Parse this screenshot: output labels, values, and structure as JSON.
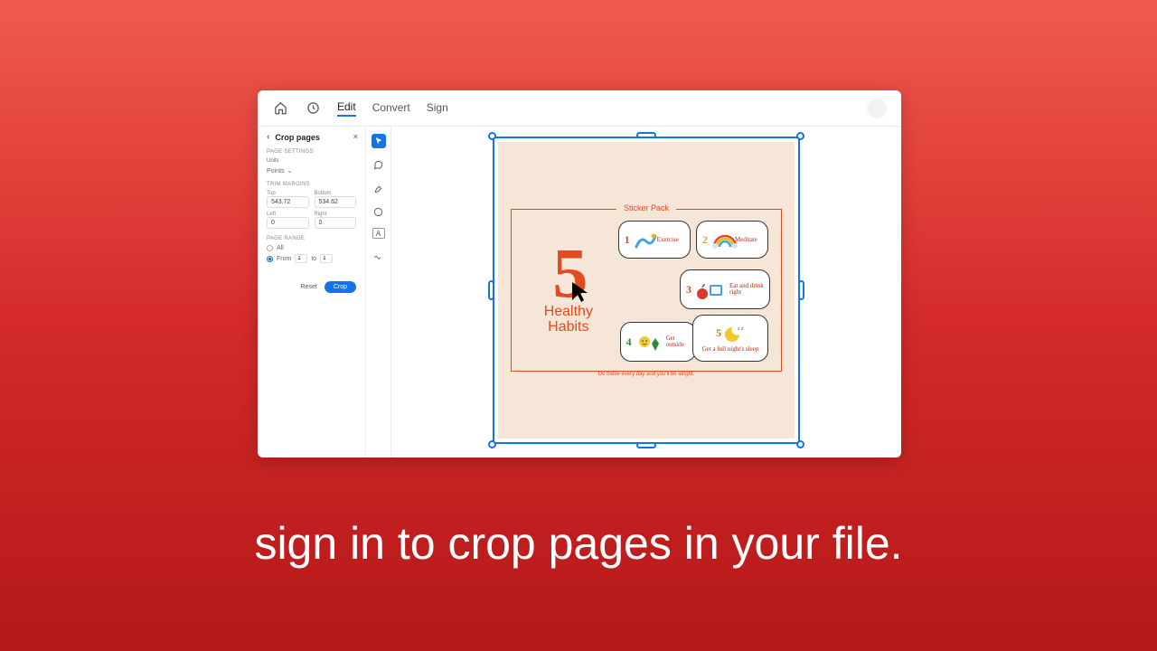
{
  "caption": "sign in to crop pages in your file.",
  "topbar": {
    "tabs": [
      "Edit",
      "Convert",
      "Sign"
    ],
    "active_tab": "Edit"
  },
  "panel": {
    "title": "Crop pages",
    "sections": {
      "page_settings": "PAGE SETTINGS",
      "units_label": "Units",
      "units_value": "Points",
      "trim_margins": "TRIM MARGINS",
      "margins": {
        "top_label": "Top",
        "top_value": "543.72",
        "bottom_label": "Bottom",
        "bottom_value": "534.62",
        "left_label": "Left",
        "left_value": "0",
        "right_label": "Right",
        "right_value": "0"
      },
      "page_range": "PAGE RANGE",
      "range_all": "All",
      "range_from": "From",
      "range_to": "to",
      "from_value": "1",
      "to_value": "1"
    },
    "actions": {
      "reset": "Reset",
      "crop": "Crop"
    }
  },
  "document": {
    "frame_title": "Sticker Pack",
    "frame_footer": "Do these every day and you'll be alright.",
    "big_number": "5",
    "headline_line1": "Healthy",
    "headline_line2": "Habits",
    "stickers": [
      {
        "num": "1",
        "label": "Exercise",
        "num_color": "#e24a1f"
      },
      {
        "num": "2",
        "label": "Meditate",
        "num_color": "#e6a817"
      },
      {
        "num": "3",
        "label": "Eat and drink right",
        "num_color": "#e24a1f"
      },
      {
        "num": "4",
        "label": "Get outside",
        "num_color": "#2a8a3a"
      },
      {
        "num": "5",
        "label": "Get a full night's sleep",
        "num_color": "#b87a1a"
      }
    ]
  }
}
